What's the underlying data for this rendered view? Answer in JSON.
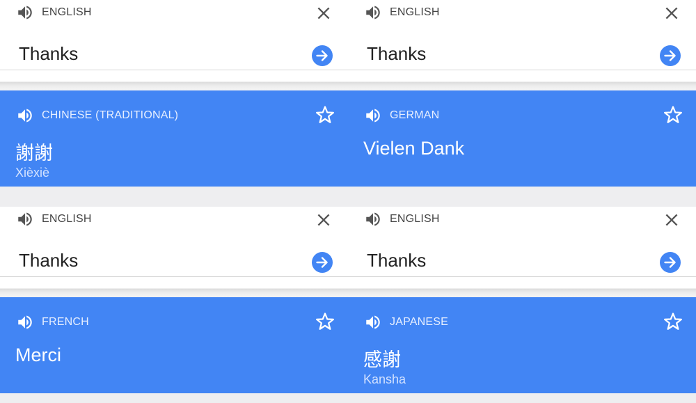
{
  "panels": [
    {
      "source_lang": "ENGLISH",
      "input_text": "Thanks",
      "target_lang": "CHINESE (TRADITIONAL)",
      "translation": "謝謝",
      "transliteration": "Xièxiè"
    },
    {
      "source_lang": "ENGLISH",
      "input_text": "Thanks",
      "target_lang": "GERMAN",
      "translation": "Vielen Dank",
      "transliteration": ""
    },
    {
      "source_lang": "ENGLISH",
      "input_text": "Thanks",
      "target_lang": "FRENCH",
      "translation": "Merci",
      "transliteration": ""
    },
    {
      "source_lang": "ENGLISH",
      "input_text": "Thanks",
      "target_lang": "JAPANESE",
      "translation": "感謝",
      "transliteration": "Kansha"
    }
  ],
  "colors": {
    "accent": "#4285f4",
    "background": "#eeeef0",
    "icon_gray": "#555555"
  },
  "icons": [
    "speaker-icon",
    "close-icon",
    "arrow-right-icon",
    "star-icon"
  ]
}
